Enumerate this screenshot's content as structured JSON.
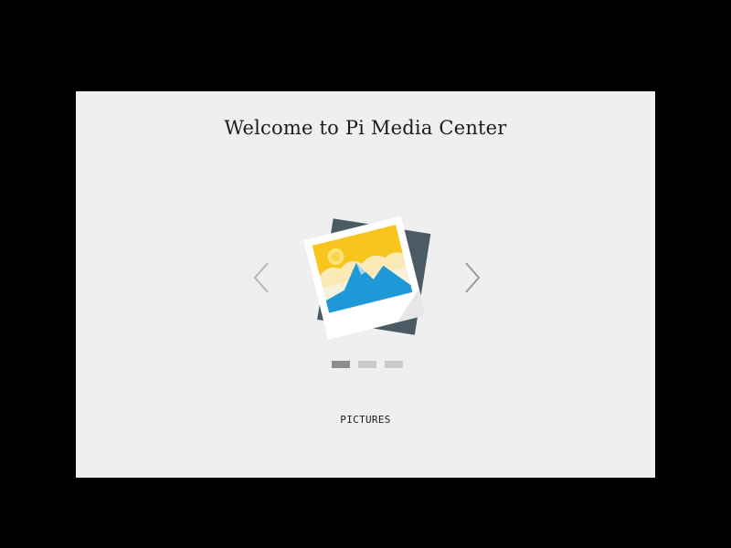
{
  "header": {
    "title": "Welcome to Pi Media Center"
  },
  "carousel": {
    "current_label": "PICTURES",
    "current_icon": "pictures-icon",
    "active_index": 0,
    "dot_count": 3,
    "prev_icon": "chevron-left-icon",
    "next_icon": "chevron-right-icon"
  },
  "colors": {
    "background": "#efeff0",
    "frame": "#000000",
    "dot_active": "#8c8c8c",
    "dot_inactive": "#c9c9c9",
    "arrow": "#9a9a9a",
    "sky": "#f7c51d",
    "mountain": "#1d9ad8",
    "photo_back": "#4a5a63"
  }
}
